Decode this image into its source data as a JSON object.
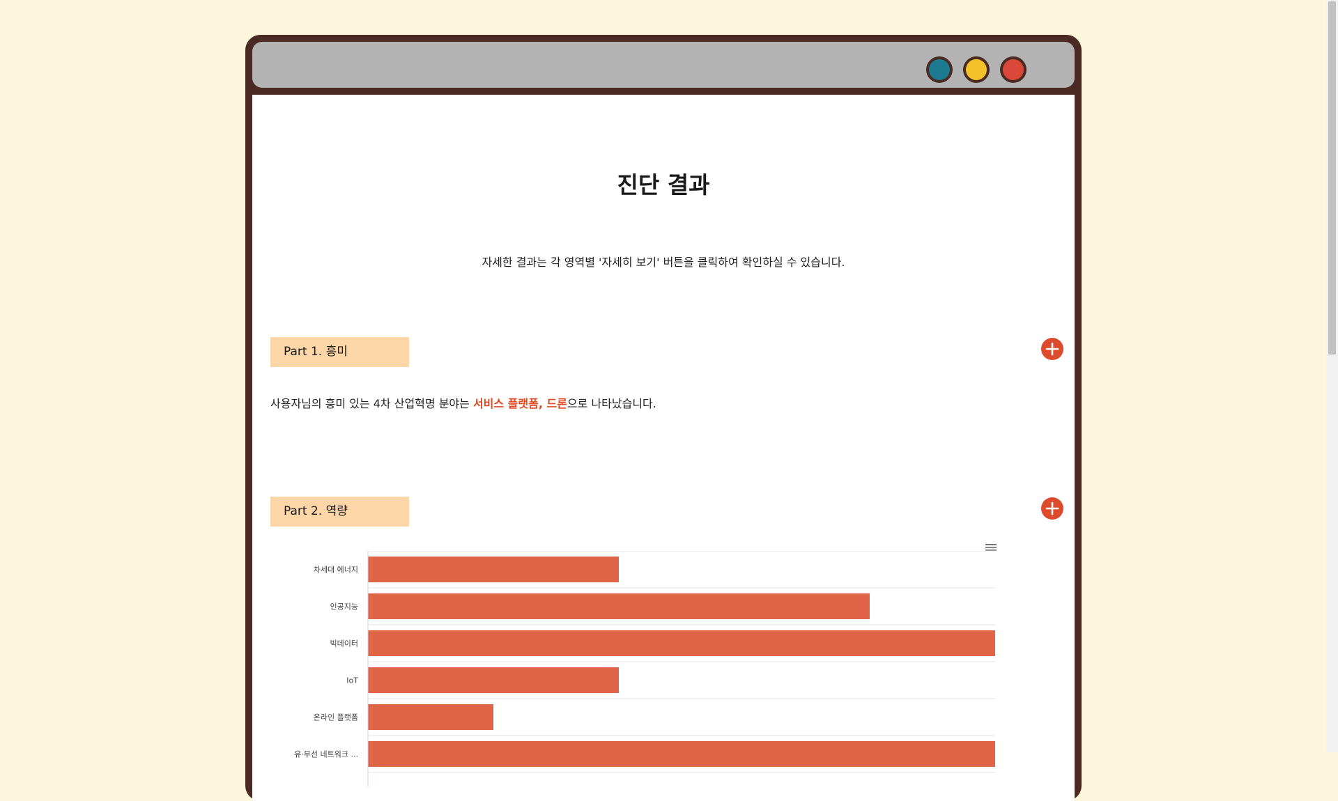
{
  "window": {
    "controls": [
      {
        "name": "teal",
        "color": "#1d7a91"
      },
      {
        "name": "yellow",
        "color": "#f3c12a"
      },
      {
        "name": "red",
        "color": "#d9483b"
      }
    ]
  },
  "page": {
    "title": "진단 결과",
    "subtitle": "자세한 결과는 각 영역별 '자세히 보기' 버튼을 클릭하여 확인하실 수 있습니다."
  },
  "part1": {
    "label": "Part 1. 흥미",
    "expand_icon": "plus-icon",
    "text_before": "사용자님의 흥미 있는 4차 산업혁명 분야는 ",
    "highlight": "서비스 플랫폼, 드론",
    "text_after": "으로 나타났습니다."
  },
  "part2": {
    "label": "Part 2. 역량",
    "expand_icon": "plus-icon",
    "menu_icon": "hamburger-menu-icon"
  },
  "colors": {
    "accent": "#dd4b2d",
    "bar": "#e06448",
    "tab_bg": "#fdd6a7",
    "page_bg": "#fdf5dc",
    "frame": "#4a2a22"
  },
  "chart_data": {
    "type": "bar",
    "orientation": "horizontal",
    "categories": [
      "차세대 에너지",
      "인공지능",
      "빅데이터",
      "IoT",
      "온라인 플랫폼",
      "유·무선 네트워크 ..."
    ],
    "values": [
      2,
      4,
      5,
      2,
      1,
      5
    ],
    "xlim": [
      0,
      5
    ],
    "grid": true,
    "legend": "none"
  }
}
